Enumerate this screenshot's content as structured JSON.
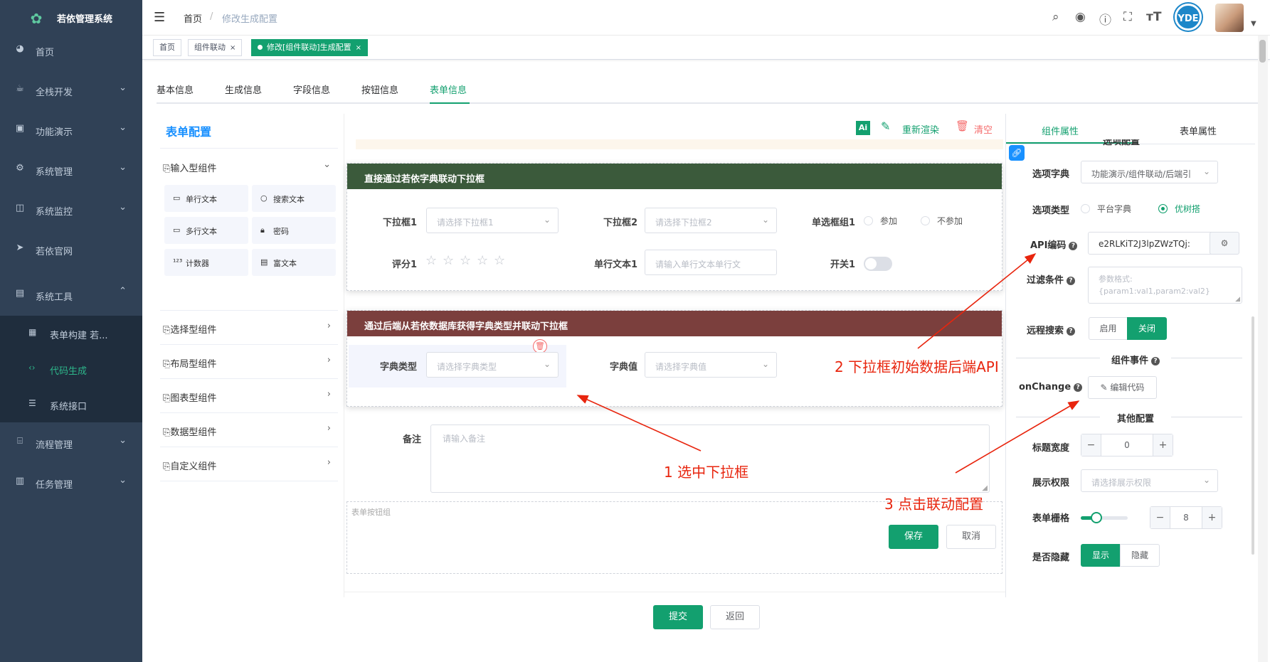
{
  "app": {
    "title": "若依管理系统"
  },
  "sidebar": {
    "items": [
      {
        "label": "首页",
        "icon": "dashboard-icon"
      },
      {
        "label": "全栈开发",
        "icon": "cup-icon"
      },
      {
        "label": "功能演示",
        "icon": "monitor-icon"
      },
      {
        "label": "系统管理",
        "icon": "gear-icon"
      },
      {
        "label": "系统监控",
        "icon": "chart-icon"
      },
      {
        "label": "若依官网",
        "icon": "send-icon"
      },
      {
        "label": "系统工具",
        "icon": "toolbox-icon"
      },
      {
        "label": "流程管理",
        "icon": "flow-icon"
      },
      {
        "label": "任务管理",
        "icon": "task-icon"
      }
    ],
    "subitems": [
      {
        "label": "表单构建 若..."
      },
      {
        "label": "代码生成"
      },
      {
        "label": "系统接口"
      }
    ]
  },
  "navbar": {
    "breadcrumb": [
      "首页",
      "修改生成配置"
    ],
    "avatar_text": "YDE"
  },
  "tags": [
    {
      "label": "首页"
    },
    {
      "label": "组件联动"
    },
    {
      "label": "修改[组件联动]生成配置"
    }
  ],
  "tabs": [
    "基本信息",
    "生成信息",
    "字段信息",
    "按钮信息",
    "表单信息"
  ],
  "left_panel": {
    "title": "表单配置",
    "groups": [
      "输入型组件",
      "选择型组件",
      "布局型组件",
      "图表型组件",
      "数据型组件",
      "自定义组件"
    ],
    "input_components": [
      "单行文本",
      "搜索文本",
      "多行文本",
      "密码",
      "计数器",
      "富文本"
    ]
  },
  "toolbar": {
    "ai_label": "Ai",
    "rerender_label": "重新渲染",
    "clear_label": "清空"
  },
  "card1": {
    "title": "直接通过若依字典联动下拉框",
    "select1_label": "下拉框1",
    "select1_ph": "请选择下拉框1",
    "select2_label": "下拉框2",
    "select2_ph": "请选择下拉框2",
    "radio_label": "单选框组1",
    "radio_opts": [
      "参加",
      "不参加"
    ],
    "rate_label": "评分1",
    "text_label": "单行文本1",
    "text_ph": "请输入单行文本单行文",
    "switch_label": "开关1"
  },
  "card2": {
    "title": "通过后端从若依数据库获得字典类型并联动下拉框",
    "type_label": "字典类型",
    "type_ph": "请选择字典类型",
    "value_label": "字典值",
    "value_ph": "请选择字典值"
  },
  "remark": {
    "label": "备注",
    "ph": "请输入备注"
  },
  "btn_group": {
    "label": "表单按钮组",
    "save": "保存",
    "cancel": "取消"
  },
  "bottom": {
    "submit": "提交",
    "back": "返回"
  },
  "right_panel": {
    "tabs": [
      "组件属性",
      "表单属性"
    ],
    "section_partial": "选项配置",
    "dict_label": "选项字典",
    "dict_value": "功能演示/组件联动/后端引",
    "type_label": "选项类型",
    "type_opts": [
      "平台字典",
      "优树搭"
    ],
    "api_label": "API编码",
    "api_value": "e2RLKiT2J3lpZWzTQj:",
    "filter_label": "过滤条件",
    "filter_ph": "参数格式:{param1:val1,param2:val2}",
    "remote_label": "远程搜索",
    "remote_opts": [
      "启用",
      "关闭"
    ],
    "events_title": "组件事件",
    "onchange_label": "onChange",
    "edit_code": "编辑代码",
    "other_title": "其他配置",
    "title_width_label": "标题宽度",
    "title_width_value": "0",
    "perm_label": "展示权限",
    "perm_ph": "请选择展示权限",
    "grid_label": "表单栅格",
    "grid_value": "8",
    "hidden_label": "是否隐藏",
    "hidden_opts": [
      "显示",
      "隐藏"
    ]
  },
  "annotations": [
    "1 选中下拉框",
    "2 下拉框初始数据后端API",
    "3 点击联动配置"
  ],
  "colors": {
    "primary": "#13a06f",
    "sidebar": "#304156",
    "card1_header": "#3b5a3b",
    "card2_header": "#7b3f3d",
    "annotation": "#e8250e"
  }
}
